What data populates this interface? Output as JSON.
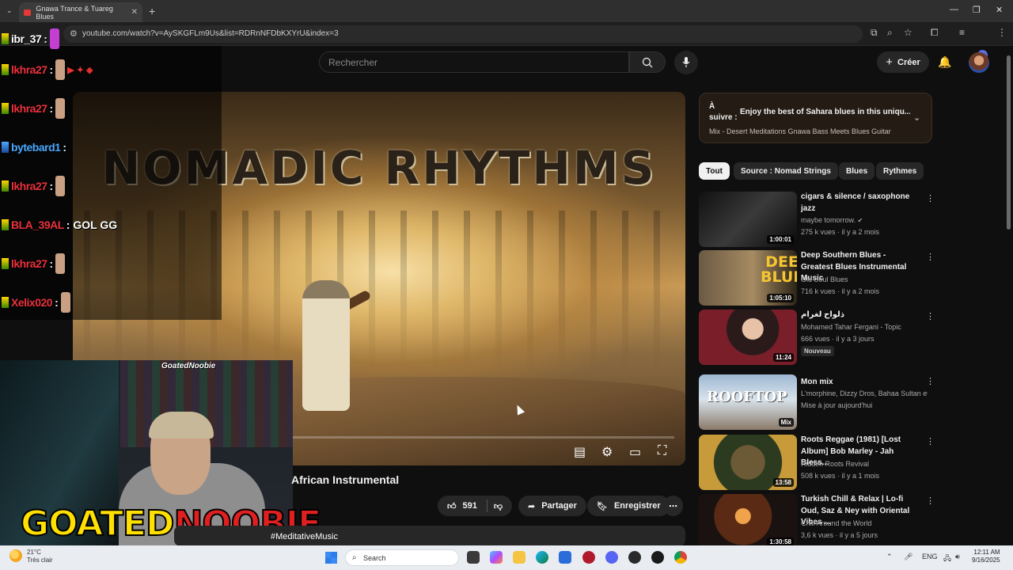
{
  "browser": {
    "tab_title": "Gnawa Trance & Tuareg Blues",
    "url": "youtube.com/watch?v=AySKGFLm9Us&list=RDRnNFDbKXYrU&index=3"
  },
  "header": {
    "search_placeholder": "Rechercher",
    "create_label": "Créer"
  },
  "player": {
    "overlay_title": "NOMADIC RHYTHMS"
  },
  "video": {
    "title": "African Instrumental",
    "likes": "591",
    "share_label": "Partager",
    "save_label": "Enregistrer",
    "desc_tag": "#MeditativeMusic"
  },
  "chat": [
    {
      "name": "ibr_37",
      "color": "#ffffff",
      "msg": ":"
    },
    {
      "name": "lkhra27",
      "color": "#e8323c",
      "msg": ":"
    },
    {
      "name": "lkhra27",
      "color": "#e8323c",
      "msg": ":"
    },
    {
      "name": "bytebard1",
      "color": "#4aa8ff",
      "msg": ":"
    },
    {
      "name": "lkhra27",
      "color": "#e8323c",
      "msg": ":"
    },
    {
      "name": "BLA_39AL",
      "color": "#e8323c",
      "msg": ": GOL GG"
    },
    {
      "name": "lkhra27",
      "color": "#e8323c",
      "msg": ":"
    },
    {
      "name": "Xelix020",
      "color": "#e8323c",
      "msg": ":"
    }
  ],
  "stream": {
    "cam_tag": "GoatedNoobie",
    "brand_part1": "GOATED",
    "brand_part2": "NOOBIE"
  },
  "upnext": {
    "label": "À suivre :",
    "title": "Enjoy the best of Sahara blues in this uniqu...",
    "subtitle": "Mix - Desert Meditations Gnawa Bass Meets Blues Guitar"
  },
  "chips": [
    "Tout",
    "Source : Nomad Strings",
    "Blues",
    "Rythmes"
  ],
  "recommendations": [
    {
      "title": "cigars & silence / saxophone jazz",
      "channel": "maybe tomorrow.",
      "meta": "275 k vues · il y a 2 mois",
      "duration": "1:00:01",
      "badge": ""
    },
    {
      "title": "Deep Southern Blues - Greatest Blues Instrumental Music",
      "channel": "Old Soul Blues",
      "meta": "716 k vues · il y a 2 mois",
      "duration": "1:05:10",
      "badge": ""
    },
    {
      "title": "ذلواح لغرام",
      "channel": "Mohamed Tahar Fergani - Topic",
      "meta": "666 vues · il y a 3 jours",
      "duration": "11:24",
      "badge": "Nouveau"
    },
    {
      "title": "Mon mix",
      "channel": "L'morphine, Dizzy Dros, Bahaa Sultan et ...",
      "meta": "Mise à jour aujourd'hui",
      "duration": "Mix",
      "badge": ""
    },
    {
      "title": "Roots Reggae (1981) [Lost Album] Bob Marley - Jah Bless...",
      "channel": "Riddim Roots Revival",
      "meta": "508 k vues · il y a 1 mois",
      "duration": "13:58",
      "badge": ""
    },
    {
      "title": "Turkish Chill & Relax | Lo-fi Oud, Saz & Ney with Oriental Vibes ...",
      "channel": "Chill Around the World",
      "meta": "3,6 k vues · il y a 5 jours",
      "duration": "1:30:58",
      "badge": ""
    }
  ],
  "taskbar": {
    "temp": "21°C",
    "weather": "Très clair",
    "search_label": "Search",
    "lang": "ENG",
    "time": "12:11 AM",
    "date": "9/16/2025"
  }
}
